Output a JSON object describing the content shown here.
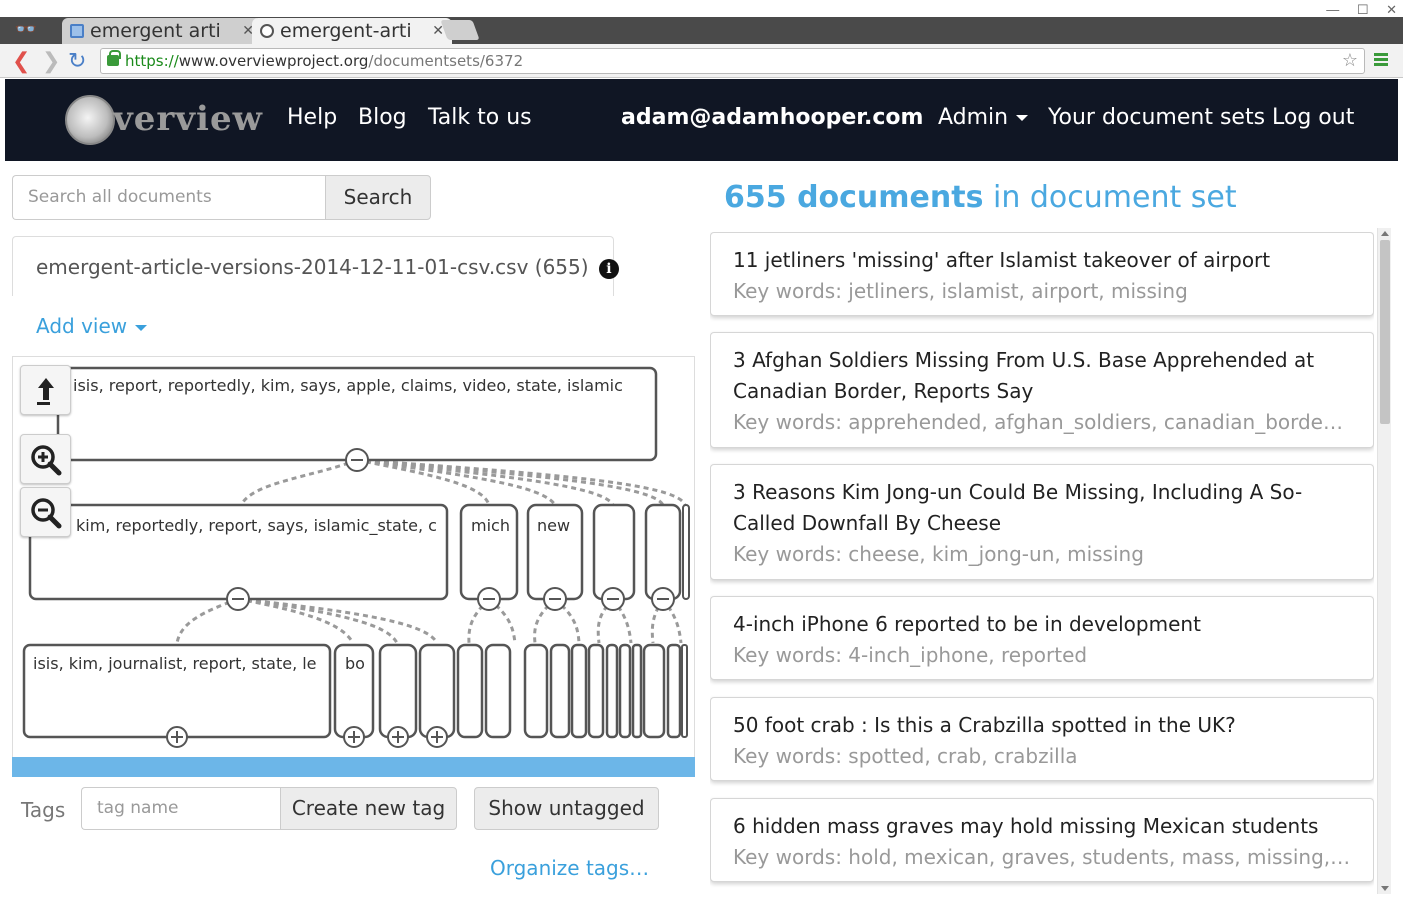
{
  "browser": {
    "tabs": [
      {
        "label": "emergent arti",
        "active": false
      },
      {
        "label": "emergent-arti",
        "active": true
      }
    ],
    "url": {
      "scheme": "https://",
      "host": "www.overviewproject.org",
      "path": "/documentsets/6372"
    }
  },
  "navbar": {
    "logo": "verview",
    "links": {
      "help": "Help",
      "blog": "Blog",
      "talk": "Talk to us",
      "email": "adam@adamhooper.com",
      "admin": "Admin",
      "docsets": "Your document sets",
      "logout": "Log out"
    },
    "bg_color": "#101624"
  },
  "search": {
    "placeholder": "Search all documents",
    "button": "Search"
  },
  "docset": {
    "title": "emergent-article-versions-2014-12-11-01-csv.csv (655)",
    "add_view": "Add view"
  },
  "tree": {
    "labels": {
      "root": "isis, report, reportedly, kim, says, apple, claims, video, state, islamic",
      "level1_main": "kim, reportedly, report, says, islamic_state, c",
      "level1_b": "mich",
      "level1_c": "new",
      "level2_main": "isis, kim, journalist, report, state, le",
      "level2_b": "bo"
    }
  },
  "tags": {
    "label": "Tags",
    "placeholder": "tag name",
    "create_button": "Create new tag",
    "untagged_button": "Show untagged",
    "organize_link": "Organize tags…"
  },
  "documents": {
    "count": "655 documents",
    "heading_suffix": " in document set",
    "items": [
      {
        "title": "11 jetliners 'missing' after Islamist takeover of airport",
        "keywords": "Key words: jetliners, islamist, airport, missing"
      },
      {
        "title": "3 Afghan Soldiers Missing From U.S. Base Apprehended at Canadian Border, Reports Say",
        "keywords": "Key words: apprehended, afghan_soldiers, canadian_border, …"
      },
      {
        "title": "3 Reasons Kim Jong-un Could Be Missing, Including A So-Called Downfall By Cheese",
        "keywords": "Key words: cheese, kim_jong-un, missing"
      },
      {
        "title": "4-inch iPhone 6 reported to be in development",
        "keywords": "Key words: 4-inch_iphone, reported"
      },
      {
        "title": "50 foot crab : Is this a Crabzilla spotted in the UK?",
        "keywords": "Key words: spotted, crab, crabzilla"
      },
      {
        "title": "6 hidden mass graves may hold missing Mexican students",
        "keywords": "Key words: hold, mexican, graves, students, mass, missing, m…"
      }
    ],
    "accent_color": "#4aa8e0"
  }
}
